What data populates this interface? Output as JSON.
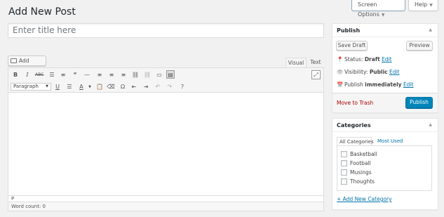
{
  "header": {
    "page_title": "Add New Post",
    "screen_options_label": "Screen Options",
    "help_label": "Help"
  },
  "editor": {
    "title_placeholder": "Enter title here",
    "add_media_label": "Add Media",
    "tab_visual": "Visual",
    "tab_text": "Text",
    "format_select_value": "Paragraph",
    "path_indicator": "P",
    "word_count_label": "Word count: 0",
    "toolbar_row1": [
      "bold-icon",
      "italic-icon",
      "strikethrough-icon",
      "bullet-list-icon",
      "numbered-list-icon",
      "blockquote-icon",
      "horizontal-line-icon",
      "align-left-icon",
      "align-center-icon",
      "align-right-icon",
      "insert-link-icon",
      "remove-link-icon",
      "read-more-icon",
      "toolbar-toggle-icon"
    ],
    "toolbar_row2": [
      "underline-icon",
      "justify-icon",
      "text-color-icon",
      "paste-as-text-icon",
      "clear-formatting-icon",
      "special-character-icon",
      "decrease-indent-icon",
      "increase-indent-icon",
      "undo-icon",
      "redo-icon",
      "help-icon"
    ],
    "fullscreen_icon": "fullscreen-icon"
  },
  "publish": {
    "heading": "Publish",
    "save_draft_label": "Save Draft",
    "preview_label": "Preview",
    "status_label": "Status:",
    "status_value": "Draft",
    "visibility_label": "Visibility:",
    "visibility_value": "Public",
    "publish_label": "Publish",
    "publish_value": "immediately",
    "edit_link": "Edit",
    "trash_label": "Move to Trash",
    "publish_button_label": "Publish",
    "accent_color": "#0085ba",
    "trash_color": "#aa0000"
  },
  "categories": {
    "heading": "Categories",
    "tab_all": "All Categories",
    "tab_most_used": "Most Used",
    "items": [
      {
        "label": "Basketball",
        "checked": false
      },
      {
        "label": "Football",
        "checked": false
      },
      {
        "label": "Musings",
        "checked": false
      },
      {
        "label": "Thoughts",
        "checked": false
      }
    ],
    "add_new_label": "+ Add New Category"
  }
}
